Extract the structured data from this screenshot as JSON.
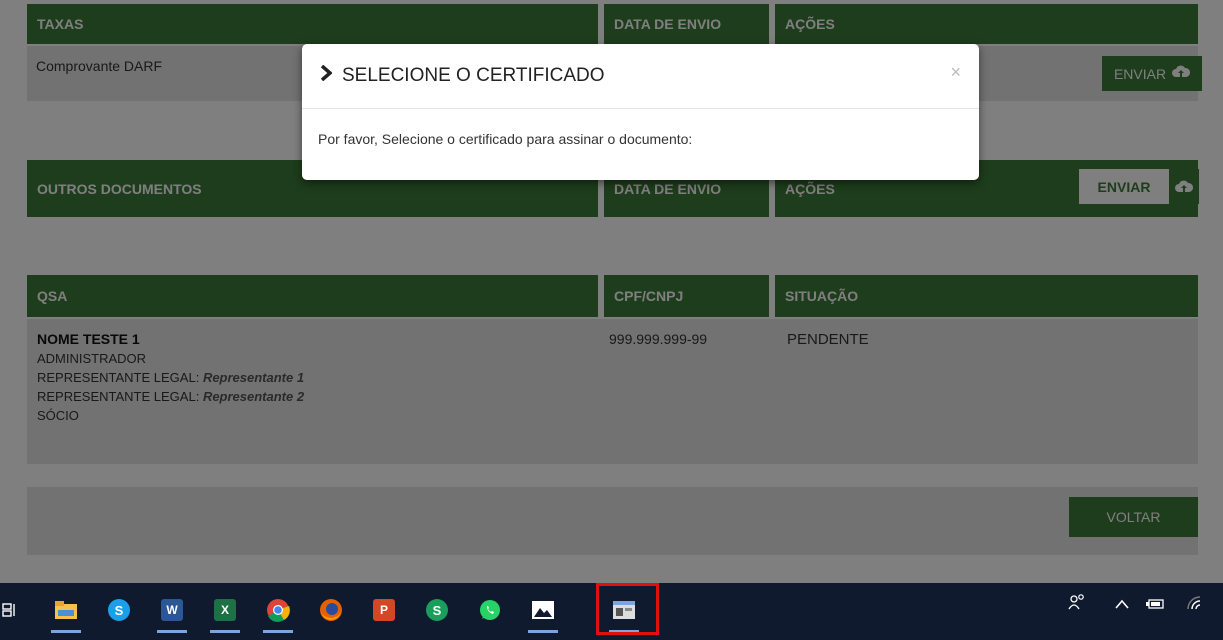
{
  "taxas": {
    "header": "TAXAS",
    "date_header": "DATA DE ENVIO",
    "actions_header": "AÇÕES",
    "row_label": "Comprovante DARF",
    "send_label": "ENVIAR"
  },
  "outros": {
    "header": "OUTROS DOCUMENTOS",
    "date_header": "DATA DE ENVIO",
    "actions_header": "AÇÕES",
    "send_label": "ENVIAR"
  },
  "qsa": {
    "header": "QSA",
    "doc_header": "CPF/CNPJ",
    "status_header": "SITUAÇÃO",
    "name": "NOME TESTE 1",
    "role1": "ADMINISTRADOR",
    "rep_label": "REPRESENTANTE LEGAL:",
    "rep1": "Representante 1",
    "rep2": "Representante 2",
    "role2": "SÓCIO",
    "doc": "999.999.999-99",
    "status": "PENDENTE"
  },
  "footer": {
    "back_label": "VOLTAR"
  },
  "modal": {
    "title": "SELECIONE O CERTIFICADO",
    "close": "×",
    "body": "Por favor, Selecione o certificado para assinar o documento:"
  },
  "taskbar": {
    "word": "W",
    "excel": "X",
    "powerpoint": "P",
    "skype": "S",
    "sheets": "S"
  },
  "colors": {
    "accent": "#3d7a39",
    "row_bg": "#e4e4e4",
    "taskbar": "#101a2e",
    "highlight": "#e01010"
  }
}
